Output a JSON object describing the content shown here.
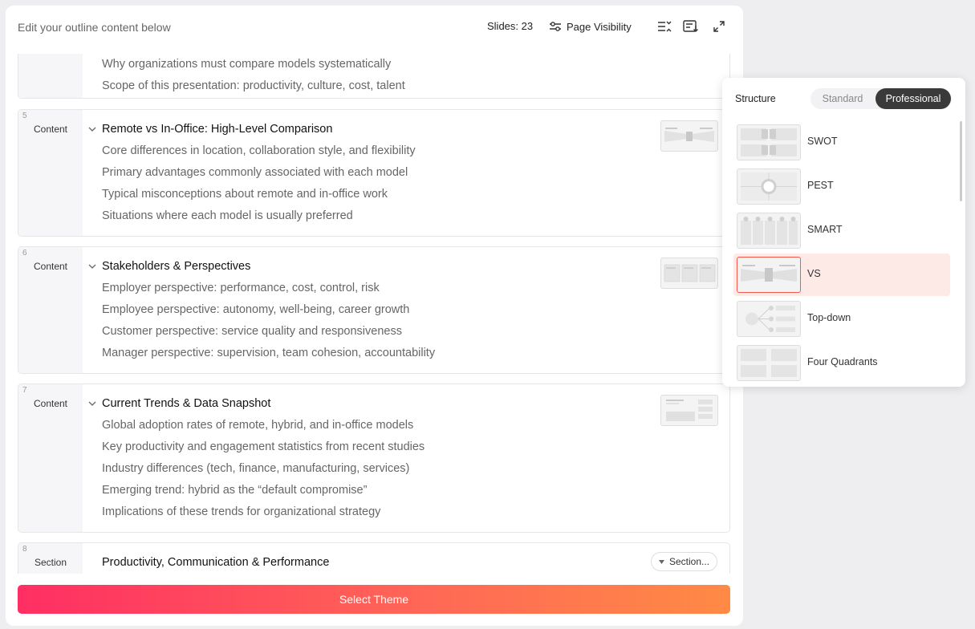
{
  "header": {
    "hint": "Edit your outline content below",
    "slides_count": "Slides: 23",
    "page_visibility": "Page Visibility"
  },
  "cards": [
    {
      "number": "",
      "type": "",
      "title": "",
      "bullets": [
        "Why organizations must compare models systematically",
        "Scope of this presentation: productivity, culture, cost, talent"
      ]
    },
    {
      "number": "5",
      "type": "Content",
      "title": "Remote vs In-Office: High-Level Comparison",
      "bullets": [
        "Core differences in location, collaboration style, and flexibility",
        "Primary advantages commonly associated with each model",
        "Typical misconceptions about remote and in-office work",
        "Situations where each model is usually preferred"
      ]
    },
    {
      "number": "6",
      "type": "Content",
      "title": "Stakeholders & Perspectives",
      "bullets": [
        "Employer perspective: performance, cost, control, risk",
        "Employee perspective: autonomy, well-being, career growth",
        "Customer perspective: service quality and responsiveness",
        "Manager perspective: supervision, team cohesion, accountability"
      ]
    },
    {
      "number": "7",
      "type": "Content",
      "title": "Current Trends & Data Snapshot",
      "bullets": [
        "Global adoption rates of remote, hybrid, and in-office models",
        "Key productivity and engagement statistics from recent studies",
        "Industry differences (tech, finance, manufacturing, services)",
        "Emerging trend: hybrid as the “default compromise”",
        "Implications of these trends for organizational strategy"
      ]
    },
    {
      "number": "8",
      "type": "Section",
      "title": "Productivity, Communication & Performance",
      "section_button": "Section...",
      "bullets": []
    }
  ],
  "footer": {
    "select_theme": "Select Theme"
  },
  "structure_panel": {
    "title": "Structure",
    "tabs": [
      "Standard",
      "Professional"
    ],
    "active_tab": "Professional",
    "options": [
      {
        "name": "SWOT",
        "icon": "swot-layout-thumbnail"
      },
      {
        "name": "PEST",
        "icon": "pest-layout-thumbnail"
      },
      {
        "name": "SMART",
        "icon": "smart-layout-thumbnail"
      },
      {
        "name": "VS",
        "icon": "vs-layout-thumbnail",
        "selected": true
      },
      {
        "name": "Top-down",
        "icon": "top-down-layout-thumbnail"
      },
      {
        "name": "Four Quadrants",
        "icon": "four-quadrants-layout-thumbnail"
      }
    ]
  },
  "colors": {
    "accent_gradient_start": "#ff2e63",
    "accent_gradient_end": "#ff8a45",
    "selected_bg": "#fde9e5",
    "selected_border": "#f25a4b",
    "toggle_active": "#3a3a3a"
  }
}
